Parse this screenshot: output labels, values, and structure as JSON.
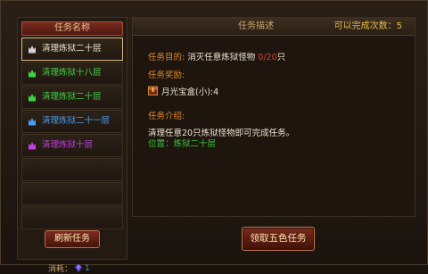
{
  "left_panel": {
    "header": "任务名称",
    "quests": [
      {
        "label": "清理炼狱二十层",
        "color": "#f2e6d0",
        "icon_color": "#d0d0d8",
        "selected": true
      },
      {
        "label": "清理炼狱十八层",
        "color": "#3fd43f",
        "icon_color": "#3fd43f",
        "selected": false
      },
      {
        "label": "清理炼狱二十层",
        "color": "#3fd43f",
        "icon_color": "#3fd43f",
        "selected": false
      },
      {
        "label": "清理炼狱二十一层",
        "color": "#4a9cf0",
        "icon_color": "#4a9cf0",
        "selected": false
      },
      {
        "label": "清理炼狱十层",
        "color": "#c040e0",
        "icon_color": "#c040e0",
        "selected": false
      }
    ],
    "refresh_button": "刷新任务",
    "cost_label": "消耗：",
    "cost_value": "1"
  },
  "right_panel": {
    "title": "任务描述",
    "completions": "可以完成次数：5",
    "goal_label": "任务目的:",
    "goal_text": "消灭任意炼狱怪物",
    "goal_progress": "0/20",
    "goal_unit": "只",
    "reward_label": "任务奖励:",
    "reward_item": "月光宝盒(小):4",
    "intro_label": "任务介绍:",
    "intro_text": "清理任意20只炼狱怪物即可完成任务。",
    "location_text": "位置：炼狱二十层"
  },
  "claim_button": "领取五色任务"
}
